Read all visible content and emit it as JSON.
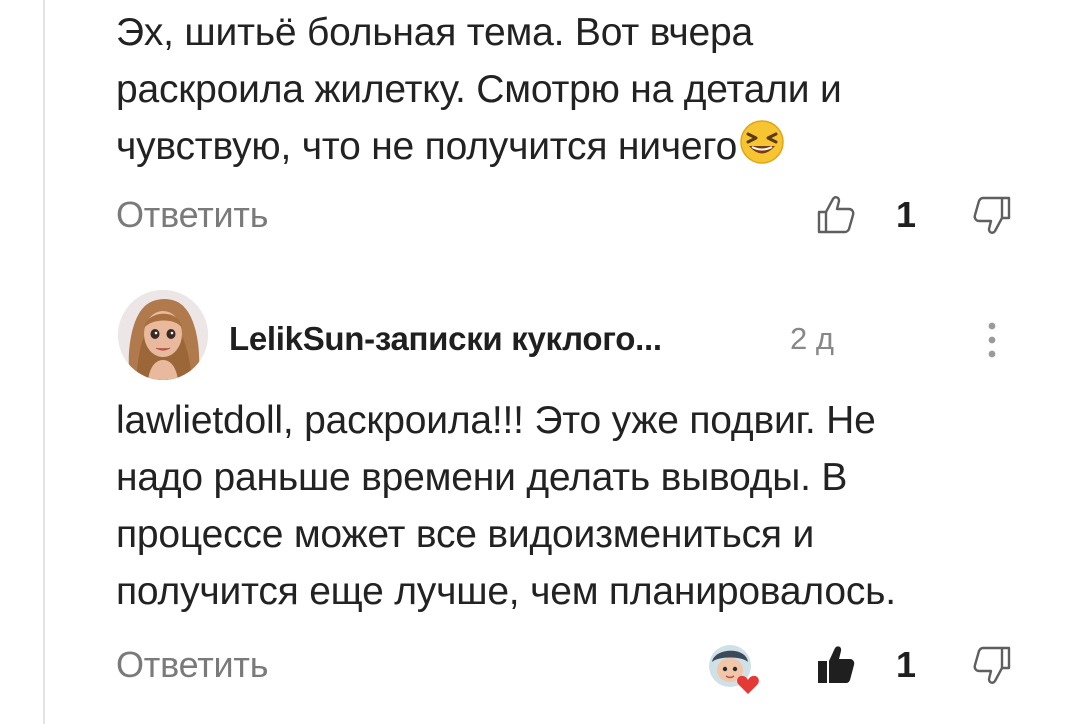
{
  "comment1": {
    "text_lines": [
      "Эх, шитьё больная тема. Вот вчера",
      "раскроила жилетку. Смотрю на детали и",
      "чувствую, что не получится ничего"
    ],
    "emoji": "laughing-squint-emoji",
    "reply_label": "Ответить",
    "like_count": "1"
  },
  "comment2": {
    "author": "LelikSun-записки куклого...",
    "time": "2 д",
    "text_lines": [
      "lawlietdoll, раскроила!!! Это уже подвиг. Не",
      "надо раньше времени делать выводы. В",
      "процессе может все видоизмениться и",
      "получится еще лучше, чем планировалось."
    ],
    "reply_label": "Ответить",
    "like_count": "1",
    "liked": true,
    "creator_heart": true
  },
  "icons": {
    "like": "thumbs-up-icon",
    "dislike": "thumbs-down-icon",
    "more": "more-vertical-icon",
    "heart": "creator-heart-icon"
  },
  "colors": {
    "text": "#222222",
    "secondary": "#7a7a7a",
    "heart": "#e53935"
  }
}
